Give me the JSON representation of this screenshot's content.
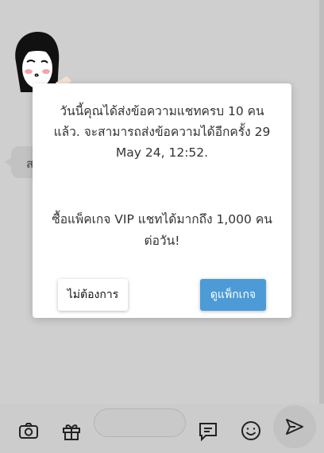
{
  "dialog": {
    "message": "วันนี้คุณได้ส่งข้อความแชทครบ 10 คนแล้ว. จะสามารถส่งข้อความได้อีกครั้ง 29 May 24, 12:52.",
    "promo": "ซื้อแพ็คเกจ VIP แชทได้มากถึง 1,000 คนต่อวัน!",
    "decline_label": "ไม่ต้องการ",
    "view_package_label": "ดูแพ็กเกจ"
  },
  "chat": {
    "partial_bubble_char": "ส"
  },
  "toolbar": {
    "icons": [
      "camera-icon",
      "gift-icon",
      "chat-icon",
      "emoji-icon",
      "send-icon"
    ],
    "message_value": ""
  },
  "colors": {
    "primary_button": "#4d9bd6",
    "overlay_background": "#cccccc",
    "dialog_background": "#ffffff"
  }
}
